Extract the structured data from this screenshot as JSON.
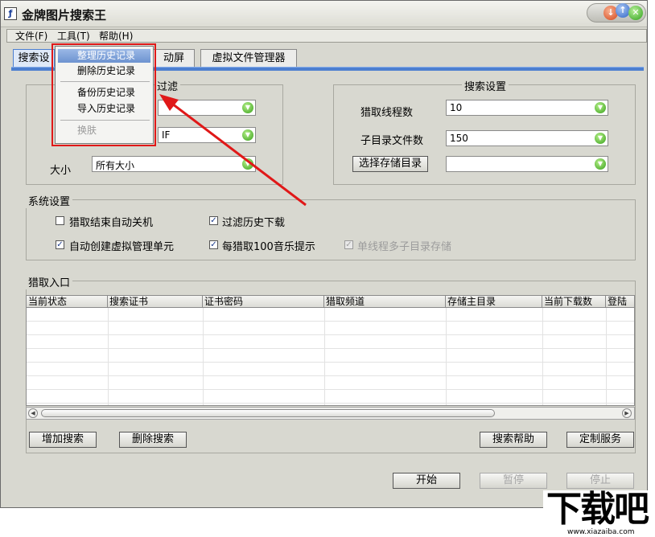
{
  "window": {
    "title": "金牌图片搜索王"
  },
  "menubar": {
    "items": [
      "文件(F)",
      "工具(T)",
      "帮助(H)"
    ]
  },
  "tabs": [
    "搜索设",
    "动屏",
    "虚拟文件管理器"
  ],
  "popup_menu": {
    "items": [
      "整理历史记录",
      "删除历史记录",
      "备份历史记录",
      "导入历史记录",
      "换肤"
    ]
  },
  "filter_group": {
    "title": "过滤",
    "combo2_value": "IF",
    "size_label": "大小",
    "size_value": "所有大小"
  },
  "search_settings": {
    "title": "搜索设置",
    "threads_label": "猎取线程数",
    "threads_value": "10",
    "subdir_label": "子目录文件数",
    "subdir_value": "150",
    "storage_button": "选择存储目录",
    "storage_value": ""
  },
  "system_settings": {
    "title": "系统设置",
    "options": [
      {
        "label": "猎取结束自动关机",
        "checked": false,
        "enabled": true
      },
      {
        "label": "过滤历史下载",
        "checked": true,
        "enabled": true
      },
      {
        "label": "自动创建虚拟管理单元",
        "checked": true,
        "enabled": true
      },
      {
        "label": "每猎取100音乐提示",
        "checked": true,
        "enabled": true
      },
      {
        "label": "单线程多子目录存储",
        "checked": true,
        "enabled": false
      }
    ]
  },
  "entry_group": {
    "title": "猎取入口",
    "columns": [
      "当前状态",
      "搜索证书",
      "证书密码",
      "猎取频道",
      "存储主目录",
      "当前下载数",
      "登陆"
    ]
  },
  "buttons": {
    "add_search": "增加搜索",
    "delete_search": "删除搜索",
    "help": "搜索帮助",
    "custom": "定制服务"
  },
  "bottom_buttons": {
    "start": "开始",
    "pause": "暂停",
    "stop": "停止"
  },
  "watermark": {
    "text": "下载吧",
    "url": "www.xiazaiba.com"
  }
}
